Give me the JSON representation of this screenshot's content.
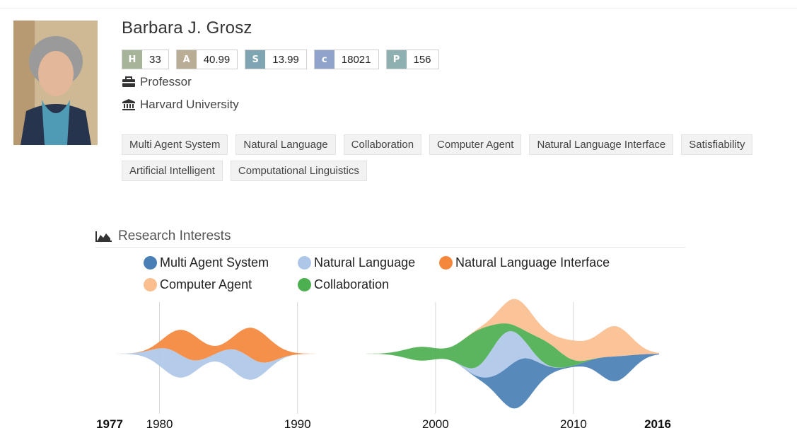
{
  "profile": {
    "name": "Barbara J. Grosz",
    "position": "Professor",
    "affiliation": "Harvard University",
    "photo_icon": "person-photo"
  },
  "metrics": [
    {
      "key": "H",
      "value": "33",
      "color": "#a6b59a"
    },
    {
      "key": "A",
      "value": "40.99",
      "color": "#b9ad95"
    },
    {
      "key": "S",
      "value": "13.99",
      "color": "#7fa5b3"
    },
    {
      "key": "c",
      "value": "18021",
      "color": "#8fa3cb"
    },
    {
      "key": "P",
      "value": "156",
      "color": "#8fb0b0"
    }
  ],
  "tags_row1": [
    "Multi Agent System",
    "Natural Language",
    "Collaboration",
    "Computer Agent",
    "Natural Language Interface",
    "Satisfiability"
  ],
  "tags_row2": [
    "Artificial Intelligent",
    "Computational Linguistics"
  ],
  "research": {
    "title": "Research Interests",
    "icon": "area-chart-icon"
  },
  "chart_data": {
    "type": "area",
    "title": "",
    "x_ticks": [
      "1977",
      "1980",
      "1990",
      "2000",
      "2010",
      "2016"
    ],
    "bold_ticks": [
      "1977",
      "2016"
    ],
    "xlim": [
      1977,
      2016
    ],
    "legend_placement": "top",
    "series": [
      {
        "name": "Multi Agent System",
        "color": "#4a7fb5",
        "peaks": [
          [
            2006,
            2.1
          ],
          [
            2013,
            1.1
          ]
        ]
      },
      {
        "name": "Natural Language",
        "color": "#aec7e8",
        "peaks": [
          [
            1981,
            1.1
          ],
          [
            1986,
            1.1
          ],
          [
            2005,
            1.6
          ]
        ]
      },
      {
        "name": "Natural Language Interface",
        "color": "#f4873c",
        "peaks": [
          [
            1982,
            1.2
          ],
          [
            1987,
            1.4
          ]
        ]
      },
      {
        "name": "Computer Agent",
        "color": "#fbbf8f",
        "peaks": [
          [
            2006,
            1.2
          ],
          [
            2010,
            0.8
          ],
          [
            2013,
            1.3
          ]
        ]
      },
      {
        "name": "Collaboration",
        "color": "#4caf50",
        "peaks": [
          [
            1999,
            0.6
          ],
          [
            2003,
            1.6
          ],
          [
            2008,
            1.0
          ]
        ]
      }
    ]
  }
}
